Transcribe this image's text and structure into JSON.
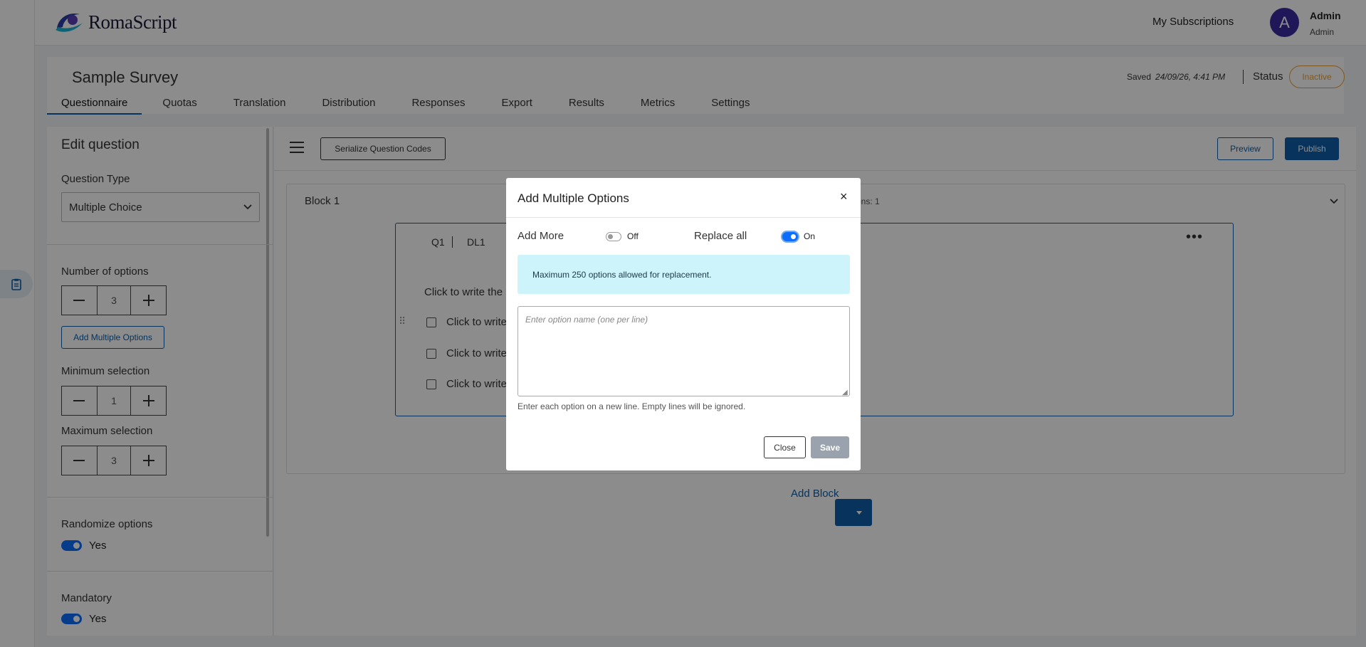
{
  "brand": {
    "name": "RomaScript",
    "accent": "#0d5ea8"
  },
  "header": {
    "my_subscriptions": "My Subscriptions",
    "avatar_letter": "A",
    "user_name": "Admin",
    "user_role": "Admin"
  },
  "survey": {
    "title": "Sample Survey",
    "saved_label": "Saved",
    "saved_time": "24/09/26, 4:41 PM",
    "status_label": "Status",
    "status_value": "Inactive",
    "tabs": [
      "Questionnaire",
      "Quotas",
      "Translation",
      "Distribution",
      "Responses",
      "Export",
      "Results",
      "Metrics",
      "Settings"
    ]
  },
  "edit_panel": {
    "title": "Edit question",
    "question_type_label": "Question Type",
    "question_type_value": "Multiple Choice",
    "num_options_label": "Number of options",
    "num_options_value": "3",
    "add_multiple_label": "Add Multiple Options",
    "min_sel_label": "Minimum selection",
    "min_sel_value": "1",
    "max_sel_label": "Maximum selection",
    "max_sel_value": "3",
    "randomize_label": "Randomize options",
    "randomize_value": "Yes",
    "mandatory_label": "Mandatory",
    "mandatory_value": "Yes"
  },
  "toolbar": {
    "serialize_label": "Serialize Question Codes",
    "preview_label": "Preview",
    "publish_label": "Publish"
  },
  "block": {
    "title": "Block 1",
    "meta": "ons: 1",
    "question": {
      "code": "Q1",
      "dl": "DL1",
      "text": "Click to write the",
      "options": [
        "Click to write",
        "Click to write",
        "Click to write"
      ]
    },
    "add_block_label": "Add Block"
  },
  "modal": {
    "title": "Add Multiple Options",
    "close_icon": "×",
    "add_more_label": "Add More",
    "add_more_state": "Off",
    "replace_all_label": "Replace all",
    "replace_all_state": "On",
    "info": "Maximum 250 options allowed for replacement.",
    "placeholder": "Enter option name (one per line)",
    "helper": "Enter each option on a new line. Empty lines will be ignored.",
    "close_label": "Close",
    "save_label": "Save"
  }
}
